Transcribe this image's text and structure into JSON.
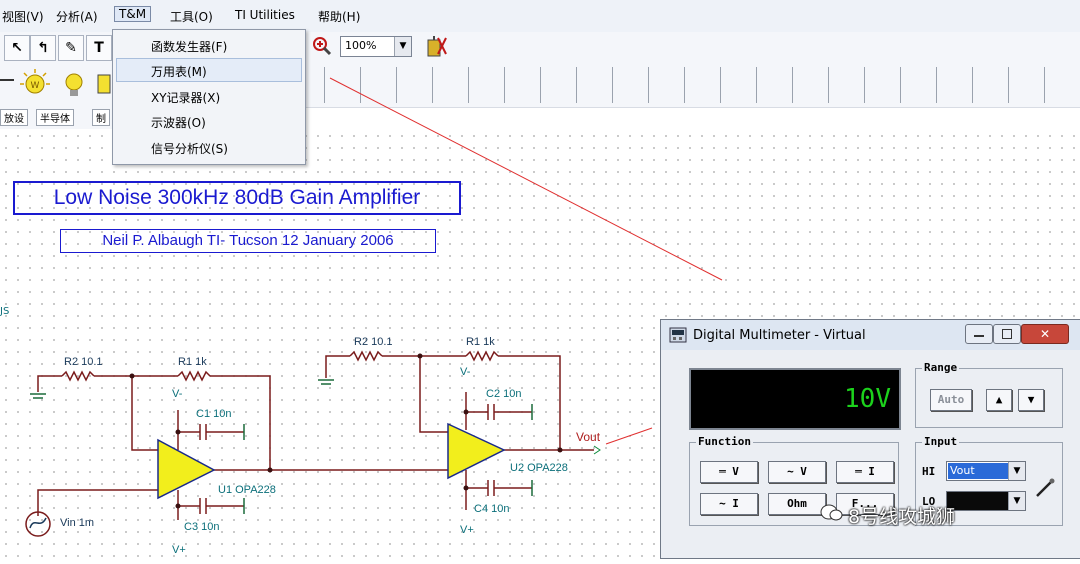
{
  "menubar": {
    "items": [
      "视图(V)",
      "分析(A)",
      "T&M",
      "工具(O)",
      "TI Utilities",
      "帮助(H)"
    ]
  },
  "toolbar": {
    "tools": [
      "select",
      "wire",
      "pen",
      "T"
    ],
    "zoom": "100%"
  },
  "toolbar3": {
    "tabs": [
      "放设",
      "半导体",
      "制"
    ]
  },
  "tm_menu": {
    "items": [
      "函数发生器(F)",
      "万用表(M)",
      "XY记录器(X)",
      "示波器(O)",
      "信号分析仪(S)"
    ],
    "highlighted": "万用表(M)"
  },
  "schematic": {
    "title": "Low Noise 300kHz 80dB Gain Amplifier",
    "subtitle": "Neil P. Albaugh  TI- Tucson  12 January 2006",
    "left_fragment": "JS",
    "stage1": {
      "r2": "R2 10.1",
      "r1": "R1 1k",
      "c1": "C1 10n",
      "c3": "C3 10n",
      "u1": "U1 OPA228",
      "vminus": "V-",
      "vplus": "V+",
      "source": "Vin 1m"
    },
    "stage2": {
      "r2": "R2 10.1",
      "r1": "R1 1k",
      "c2": "C2 10n",
      "c4": "C4 10n",
      "u2": "U2 OPA228",
      "vminus": "V-",
      "vplus": "V+",
      "vout": "Vout"
    }
  },
  "multimeter": {
    "title": "Digital Multimeter - Virtual",
    "display_value": "10V",
    "range_label": "Range",
    "auto_label": "Auto",
    "function_label": "Function",
    "functions": [
      "═ V",
      "∼ V",
      "═ I",
      "∼ I",
      "Ohm",
      "F..."
    ],
    "input_label": "Input",
    "hi_label": "HI",
    "hi_value": "Vout",
    "lo_label": "LO"
  },
  "watermark": "8号线攻城狮",
  "colors": {
    "accent": "#1a1ad0",
    "opamp": "#f2ee1c",
    "wire": "#8a2020",
    "label": "#0b6f7a",
    "display_text": "#1cd21c"
  }
}
